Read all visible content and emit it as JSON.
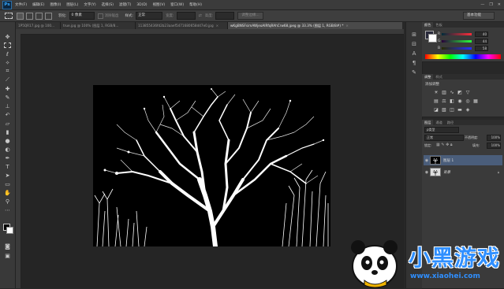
{
  "app": {
    "logo": "Ps"
  },
  "menu": [
    "文件(F)",
    "编辑(E)",
    "图像(I)",
    "图层(L)",
    "文字(Y)",
    "选择(S)",
    "滤镜(T)",
    "3D(D)",
    "视图(V)",
    "窗口(W)",
    "帮助(H)"
  ],
  "options": {
    "feather_label": "羽化:",
    "feather_value": "0 像素",
    "antialias_label": "消除锯齿",
    "style_label": "样式:",
    "style_value": "正常",
    "width_label": "宽度:",
    "height_label": "高度:",
    "refine_edge_button": "调整边缘...",
    "workspace_button": "基本功能"
  },
  "tabs": [
    {
      "label": "1P5QR17.jpg @ 100...",
      "active": false
    },
    {
      "label": "true.jpg @ 100% (图层 1, RGB/8...",
      "active": false
    },
    {
      "label": "113855436fd2b23aaef5471680658d47e0.jpg",
      "active": false
    },
    {
      "label": "wKgBNSFsimAWjeoAIRfqRAhCrw68.jpeg @ 33.3% (图层 1, RGB/8#) *",
      "active": true
    }
  ],
  "color_panel": {
    "tabs": [
      "颜色",
      "色板"
    ],
    "sliders": [
      {
        "label": "R",
        "value": "40"
      },
      {
        "label": "G",
        "value": "44"
      },
      {
        "label": "B",
        "value": "58"
      }
    ]
  },
  "adjustments_panel": {
    "tabs": [
      "调整",
      "样式"
    ],
    "heading": "添加调整"
  },
  "layers_panel": {
    "tabs": [
      "图层",
      "通道",
      "路径"
    ],
    "kind_label": "ρ类型",
    "blend_mode": "正常",
    "opacity_label": "不透明度:",
    "opacity_value": "100%",
    "lock_label": "锁定:",
    "fill_label": "填充:",
    "fill_value": "100%",
    "layers": [
      {
        "name": "图层 1",
        "selected": true
      },
      {
        "name": "背景",
        "selected": false
      }
    ]
  },
  "watermark": {
    "title": "小黑游戏",
    "url": "www.xiaohei.com"
  },
  "colors": {
    "accent": "#4a6fa5",
    "layer_selected": "#4a5d7a"
  }
}
